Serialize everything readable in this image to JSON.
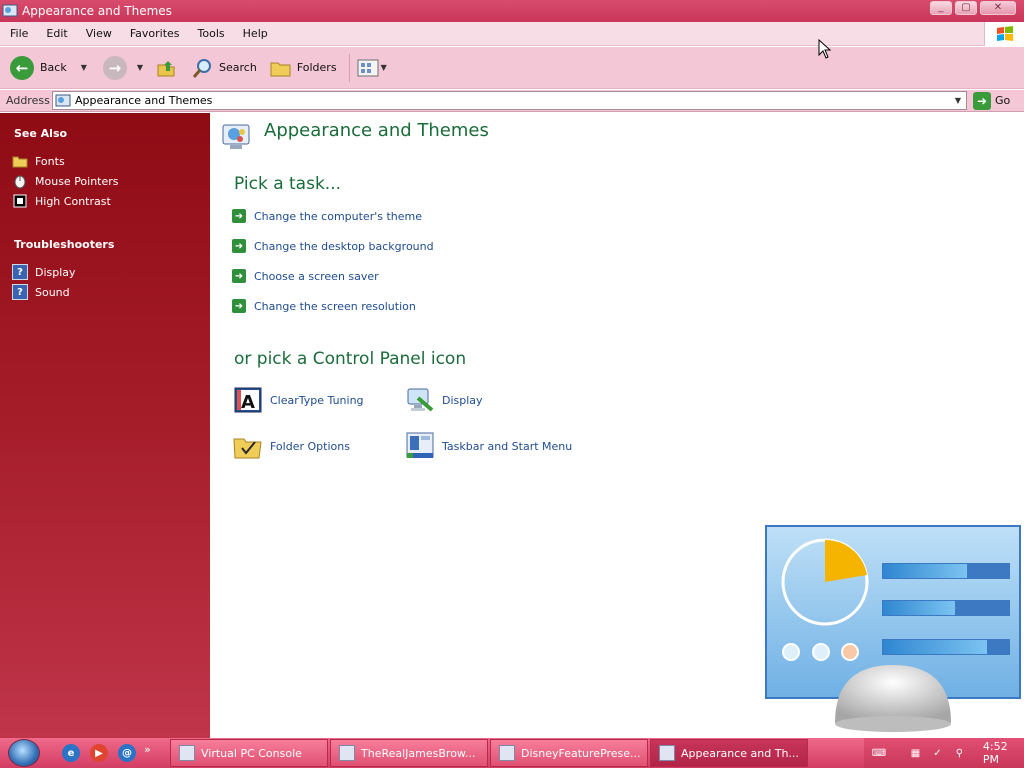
{
  "window": {
    "title": "Appearance and Themes",
    "controls": {
      "minimize": "_",
      "maximize": "▢",
      "close": "✕"
    }
  },
  "menu": [
    "File",
    "Edit",
    "View",
    "Favorites",
    "Tools",
    "Help"
  ],
  "toolbar": {
    "back_label": "Back",
    "search_label": "Search",
    "folders_label": "Folders"
  },
  "address": {
    "label": "Address",
    "value": "Appearance and Themes",
    "go_label": "Go"
  },
  "sidebar": {
    "see_also": {
      "title": "See Also",
      "items": [
        {
          "label": "Fonts",
          "icon": "folder-icon"
        },
        {
          "label": "Mouse Pointers",
          "icon": "mouse-icon"
        },
        {
          "label": "High Contrast",
          "icon": "contrast-icon"
        }
      ]
    },
    "troubleshooters": {
      "title": "Troubleshooters",
      "items": [
        {
          "label": "Display",
          "icon": "help-icon"
        },
        {
          "label": "Sound",
          "icon": "help-icon"
        }
      ]
    }
  },
  "main": {
    "title": "Appearance and Themes",
    "task_heading": "Pick a task...",
    "tasks": [
      "Change the computer's theme",
      "Change the desktop background",
      "Choose a screen saver",
      "Change the screen resolution"
    ],
    "icon_heading": "or pick a Control Panel icon",
    "icons": [
      {
        "label": "ClearType Tuning",
        "icon": "cleartype-icon"
      },
      {
        "label": "Display",
        "icon": "display-icon"
      },
      {
        "label": "Folder Options",
        "icon": "folder-options-icon"
      },
      {
        "label": "Taskbar and Start Menu",
        "icon": "taskbar-icon"
      }
    ]
  },
  "taskbar": {
    "buttons": [
      {
        "label": "Virtual PC Console",
        "active": false
      },
      {
        "label": "TheRealJamesBrow...",
        "active": false
      },
      {
        "label": "DisneyFeaturePrese...",
        "active": false
      },
      {
        "label": "Appearance and Th...",
        "active": true
      }
    ],
    "quicklaunch_more": "»",
    "clock": "4:52 PM"
  },
  "colors": {
    "title_bar": "#c8365a",
    "sidebar": "#8e0b14",
    "heading": "#1a6c3a",
    "link": "#1f4c8f"
  }
}
